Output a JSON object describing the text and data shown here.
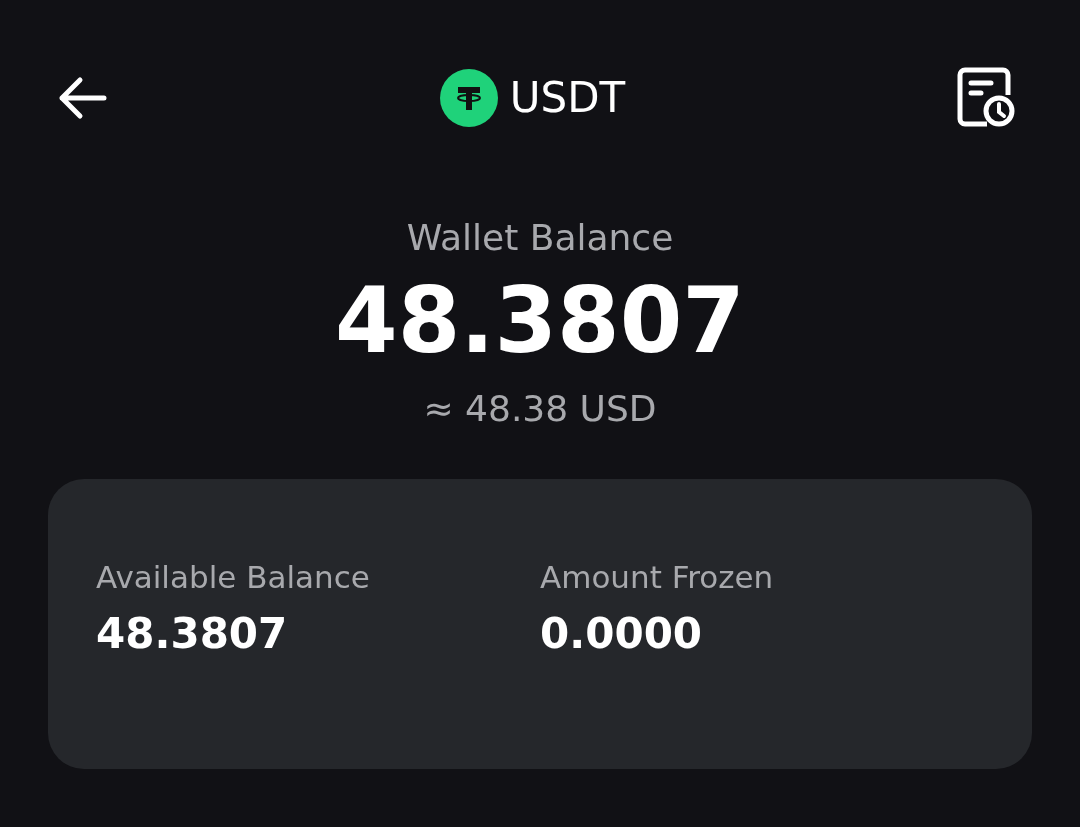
{
  "header": {
    "title": "USDT"
  },
  "balance": {
    "label": "Wallet Balance",
    "amount": "48.3807",
    "fiat": "≈ 48.38 USD"
  },
  "details": [
    {
      "label": "Available Balance",
      "value": "48.3807"
    },
    {
      "label": "Amount Frozen",
      "value": "0.0000"
    }
  ]
}
